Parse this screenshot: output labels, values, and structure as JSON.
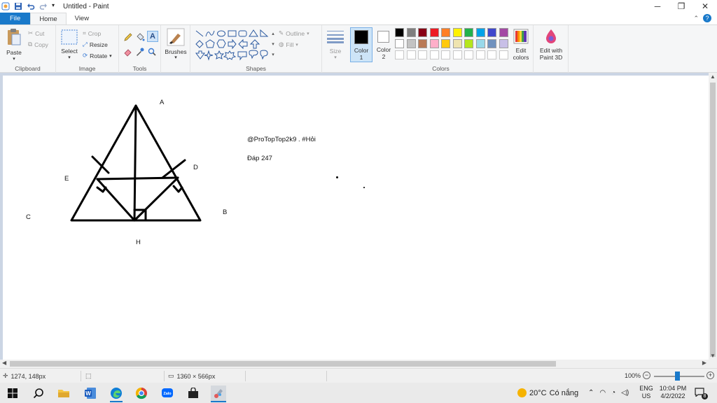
{
  "window": {
    "title": "Untitled - Paint"
  },
  "tabs": [
    {
      "label": "File"
    },
    {
      "label": "Home"
    },
    {
      "label": "View"
    }
  ],
  "ribbon": {
    "clipboard": {
      "label": "Clipboard",
      "paste": "Paste",
      "cut": "Cut",
      "copy": "Copy"
    },
    "image": {
      "label": "Image",
      "select": "Select",
      "crop": "Crop",
      "resize": "Resize",
      "rotate": "Rotate"
    },
    "tools": {
      "label": "Tools"
    },
    "brushes": {
      "label": "Brushes"
    },
    "shapes": {
      "label": "Shapes",
      "outline": "Outline",
      "fill": "Fill"
    },
    "size": {
      "label": "Size"
    },
    "color1": {
      "label1": "Color",
      "label2": "1"
    },
    "color2": {
      "label1": "Color",
      "label2": "2"
    },
    "colors": {
      "label": "Colors"
    },
    "edit_colors": {
      "label1": "Edit",
      "label2": "colors"
    },
    "paint3d": {
      "label1": "Edit with",
      "label2": "Paint 3D"
    }
  },
  "palette": {
    "row1": [
      "#000000",
      "#7f7f7f",
      "#880015",
      "#ed1c24",
      "#ff7f27",
      "#fff200",
      "#22b14c",
      "#00a2e8",
      "#3f48cc",
      "#a349a4"
    ],
    "row2": [
      "#ffffff",
      "#c3c3c3",
      "#b97a57",
      "#ffaec9",
      "#ffc90e",
      "#efe4b0",
      "#b5e61d",
      "#99d9ea",
      "#7092be",
      "#c8bfe7"
    ],
    "color1": "#000000",
    "color2": "#ffffff",
    "accent": "#1979ca"
  },
  "canvas": {
    "labels": {
      "A": "A",
      "B": "B",
      "C": "C",
      "D": "D",
      "E": "E",
      "H": "H"
    },
    "watermark": "@ProTopTop2k9 . #Hỏi",
    "watermark2": "Đáp 247"
  },
  "status": {
    "cursor_pos": "1274, 148px",
    "canvas_size": "1360 × 566px",
    "zoom": "100%"
  },
  "taskbar": {
    "weather_temp": "20°C",
    "weather_text": "Có nắng",
    "lang1": "ENG",
    "lang2": "US",
    "time": "10:04 PM",
    "date": "4/2/2022",
    "notifications": "8"
  }
}
